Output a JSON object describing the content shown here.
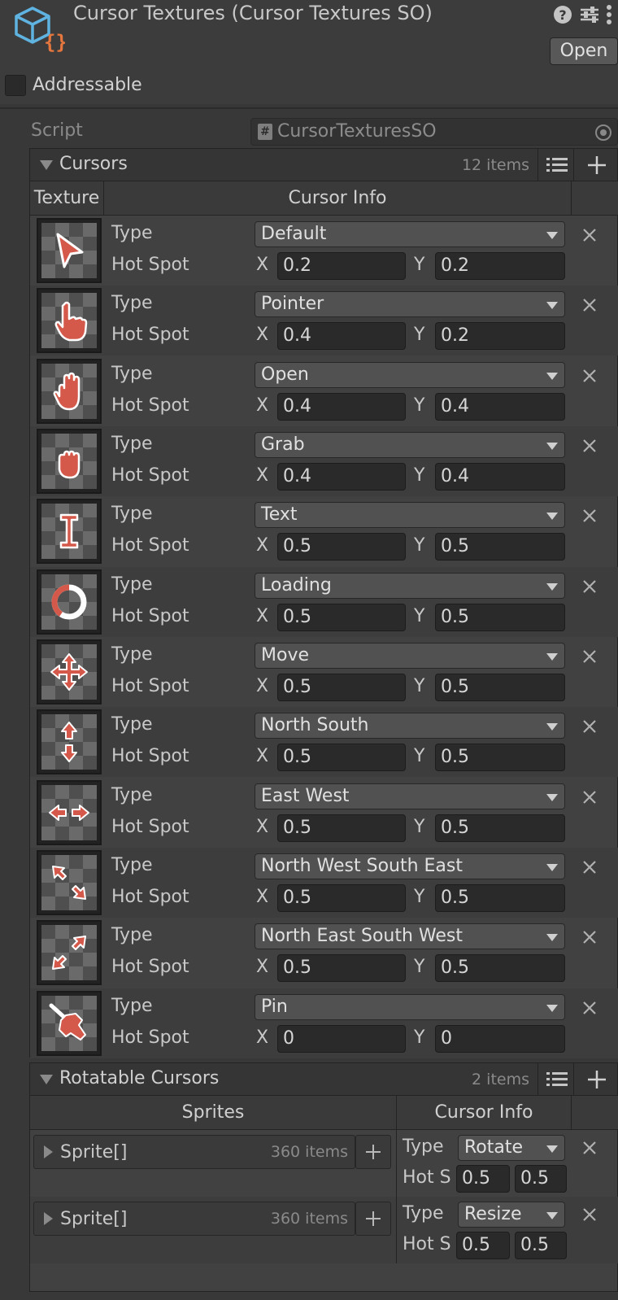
{
  "header": {
    "title": "Cursor Textures (Cursor Textures SO)",
    "open_label": "Open",
    "addressable_label": "Addressable",
    "addressable_checked": false,
    "icons": [
      "scriptable-object-icon",
      "help-icon",
      "preset-icon",
      "more-icon"
    ]
  },
  "script": {
    "label": "Script",
    "value": "CursorTexturesSO"
  },
  "cursors": {
    "title": "Cursors",
    "count": "12 items",
    "columns": {
      "texture": "Texture",
      "info": "Cursor Info"
    },
    "type_label": "Type",
    "hotspot_label": "Hot Spot",
    "x_label": "X",
    "y_label": "Y",
    "items": [
      {
        "type": "Default",
        "x": "0.2",
        "y": "0.2",
        "icon": "arrow-cursor-icon"
      },
      {
        "type": "Pointer",
        "x": "0.4",
        "y": "0.2",
        "icon": "pointer-hand-icon"
      },
      {
        "type": "Open",
        "x": "0.4",
        "y": "0.4",
        "icon": "open-hand-icon"
      },
      {
        "type": "Grab",
        "x": "0.4",
        "y": "0.4",
        "icon": "grab-hand-icon"
      },
      {
        "type": "Text",
        "x": "0.5",
        "y": "0.5",
        "icon": "text-beam-icon"
      },
      {
        "type": "Loading",
        "x": "0.5",
        "y": "0.5",
        "icon": "loading-ring-icon"
      },
      {
        "type": "Move",
        "x": "0.5",
        "y": "0.5",
        "icon": "move-arrows-icon"
      },
      {
        "type": "North South",
        "x": "0.5",
        "y": "0.5",
        "icon": "north-south-icon"
      },
      {
        "type": "East West",
        "x": "0.5",
        "y": "0.5",
        "icon": "east-west-icon"
      },
      {
        "type": "North West South East",
        "x": "0.5",
        "y": "0.5",
        "icon": "nwse-icon"
      },
      {
        "type": "North East South West",
        "x": "0.5",
        "y": "0.5",
        "icon": "nesw-icon"
      },
      {
        "type": "Pin",
        "x": "0",
        "y": "0",
        "icon": "pin-icon"
      }
    ]
  },
  "rotatable": {
    "title": "Rotatable Cursors",
    "count": "2 items",
    "columns": {
      "sprites": "Sprites",
      "info": "Cursor Info"
    },
    "type_label": "Type",
    "hotspot_label": "Hot S",
    "items": [
      {
        "sprite_label": "Sprite[]",
        "sprite_count": "360 items",
        "type": "Rotate",
        "x": "0.5",
        "y": "0.5"
      },
      {
        "sprite_label": "Sprite[]",
        "sprite_count": "360 items",
        "type": "Resize",
        "x": "0.5",
        "y": "0.5"
      }
    ]
  },
  "colors": {
    "background": "#383838",
    "cursor_accent": "#d4594a",
    "icon_accent": "#5fb3e0"
  }
}
